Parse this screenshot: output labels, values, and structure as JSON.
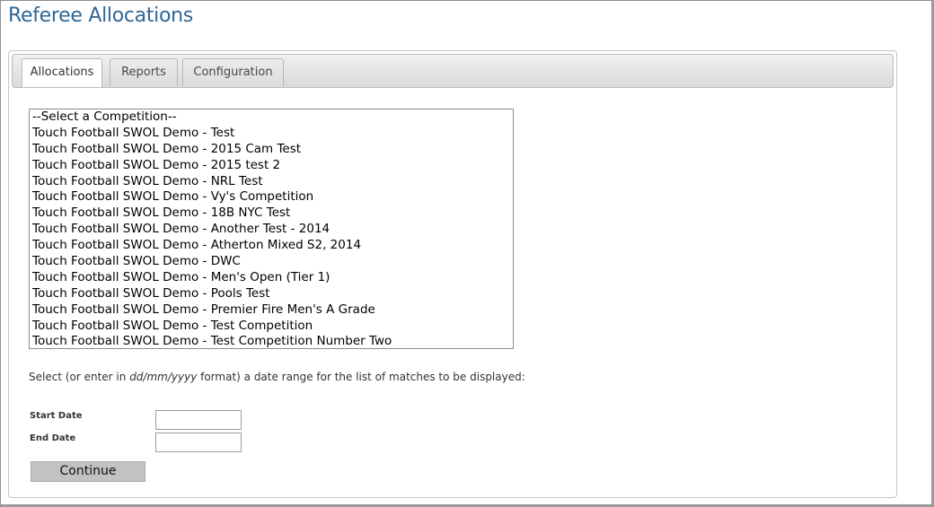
{
  "page": {
    "title": "Referee Allocations"
  },
  "tabs": [
    {
      "label": "Allocations",
      "active": true
    },
    {
      "label": "Reports",
      "active": false
    },
    {
      "label": "Configuration",
      "active": false
    }
  ],
  "competition_list": {
    "options": [
      "--Select a Competition--",
      "Touch Football SWOL Demo - Test",
      "Touch Football SWOL Demo - 2015 Cam Test",
      "Touch Football SWOL Demo - 2015 test 2",
      "Touch Football SWOL Demo - NRL Test",
      "Touch Football SWOL Demo - Vy's Competition",
      "Touch Football SWOL Demo - 18B NYC Test",
      "Touch Football SWOL Demo - Another Test - 2014",
      "Touch Football SWOL Demo - Atherton Mixed S2, 2014",
      "Touch Football SWOL Demo - DWC",
      "Touch Football SWOL Demo - Men's Open (Tier 1)",
      "Touch Football SWOL Demo - Pools Test",
      "Touch Football SWOL Demo - Premier Fire Men's A Grade",
      "Touch Football SWOL Demo - Test Competition",
      "Touch Football SWOL Demo - Test Competition Number Two"
    ]
  },
  "date_range": {
    "instruction_before": "Select (or enter in ",
    "instruction_format": "dd/mm/yyyy",
    "instruction_after": " format) a date range for the list of matches to be displayed:",
    "start_label": "Start Date",
    "start_value": "",
    "end_label": "End Date",
    "end_value": ""
  },
  "actions": {
    "continue_label": "Continue"
  },
  "colors": {
    "title": "#2f6796",
    "button_bg": "#c2c2c2"
  }
}
